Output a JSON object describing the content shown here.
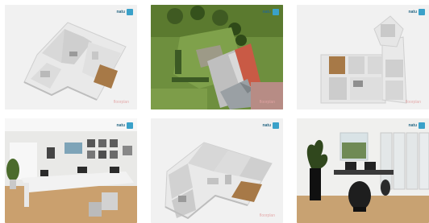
{
  "logo": {
    "text": "natu",
    "color": "#3aa1c9"
  },
  "watermark": {
    "text": "floorplan"
  },
  "tiles": [
    {
      "name": "floorplan-3d-a",
      "kind": "floorplan"
    },
    {
      "name": "aerial-garden-house",
      "kind": "aerial"
    },
    {
      "name": "floorplan-3d-b",
      "kind": "floorplan"
    },
    {
      "name": "office-interior-a",
      "kind": "interior"
    },
    {
      "name": "floorplan-3d-c",
      "kind": "floorplan"
    },
    {
      "name": "office-interior-b",
      "kind": "interior"
    }
  ]
}
